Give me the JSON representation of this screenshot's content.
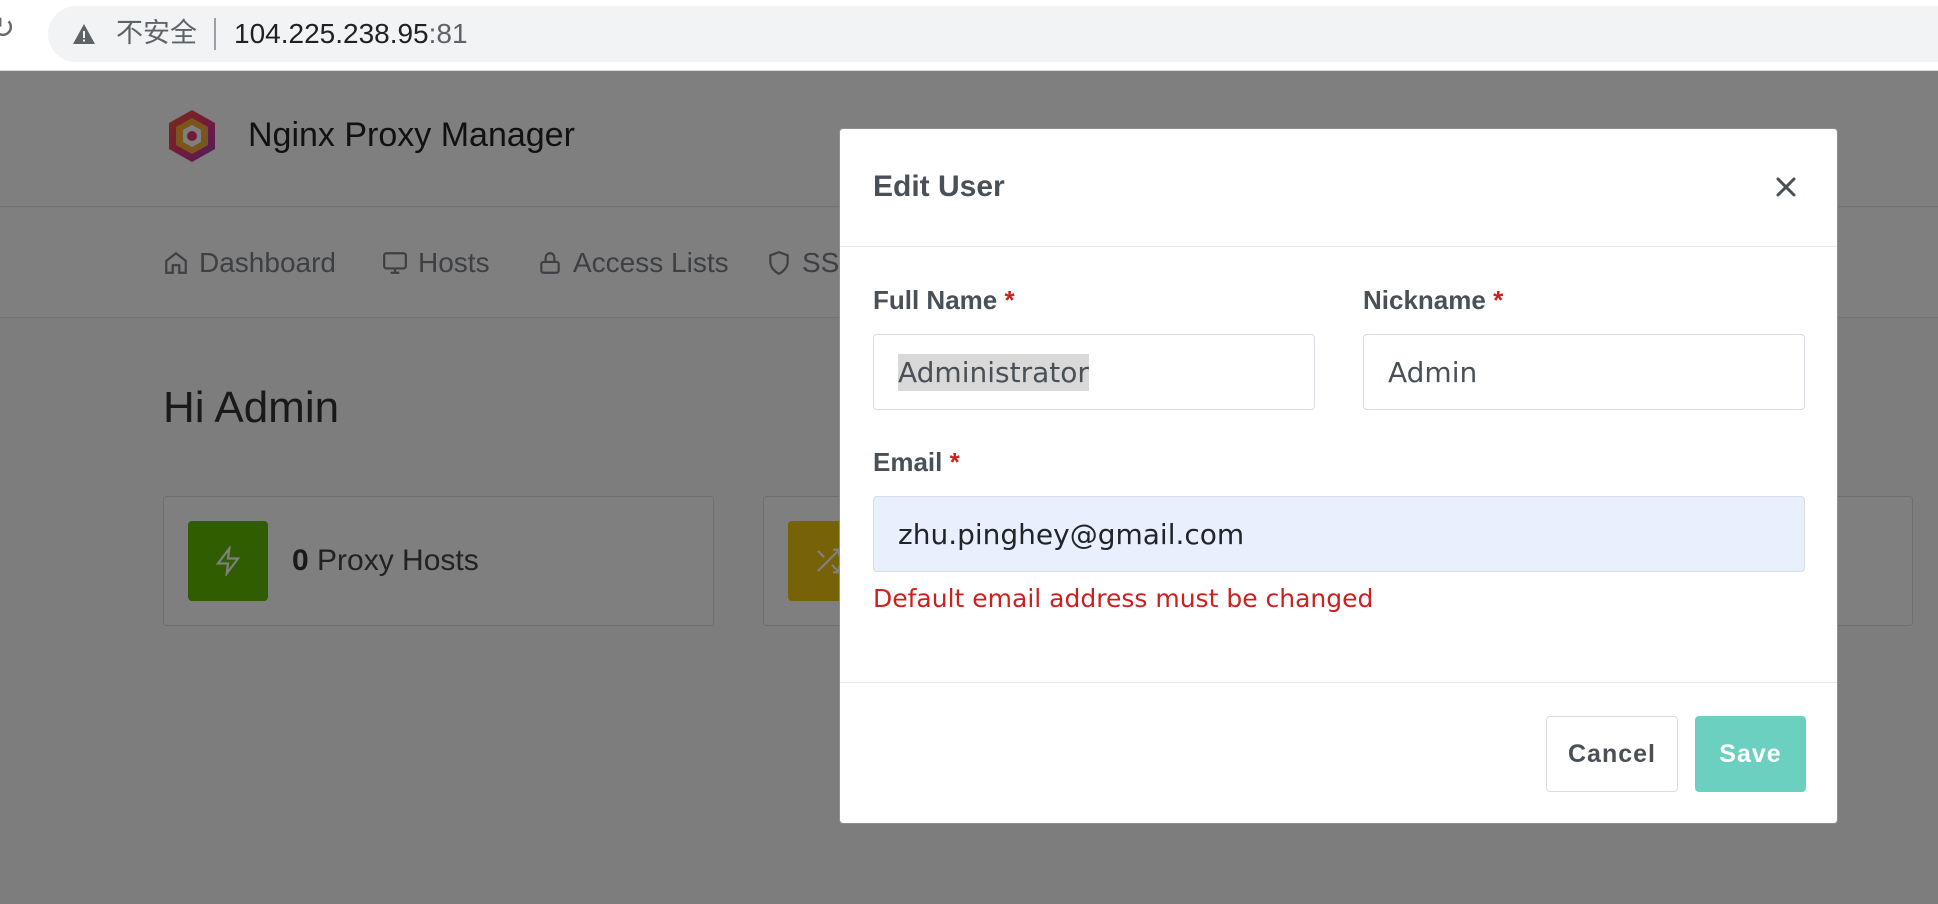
{
  "browser": {
    "security_label": "不安全",
    "url_host": "104.225.238.95",
    "url_port": ":81"
  },
  "app": {
    "brand": "Nginx Proxy Manager",
    "nav": [
      {
        "label": "Dashboard",
        "icon": "home-icon"
      },
      {
        "label": "Hosts",
        "icon": "monitor-icon"
      },
      {
        "label": "Access Lists",
        "icon": "lock-icon"
      },
      {
        "label": "SSL",
        "icon": "shield-icon"
      }
    ],
    "greeting": "Hi Admin",
    "cards": [
      {
        "count": "0",
        "label": "Proxy Hosts",
        "color": "#5eba00",
        "icon": "zap-icon"
      },
      {
        "color": "#f1c40f",
        "icon": "shuffle-icon"
      }
    ]
  },
  "modal": {
    "title": "Edit User",
    "full_name": {
      "label": "Full Name",
      "required": "*",
      "value": "Administrator"
    },
    "nickname": {
      "label": "Nickname",
      "required": "*",
      "value": "Admin"
    },
    "email": {
      "label": "Email",
      "required": "*",
      "value": "zhu.pinghey@gmail.com",
      "error": "Default email address must be changed"
    },
    "cancel_label": "Cancel",
    "save_label": "Save"
  },
  "colors": {
    "overlay": "rgba(0,0,0,0.5)",
    "error": "#cd201f",
    "save": "#6cd0c1",
    "autofill": "#e8f0fe"
  }
}
